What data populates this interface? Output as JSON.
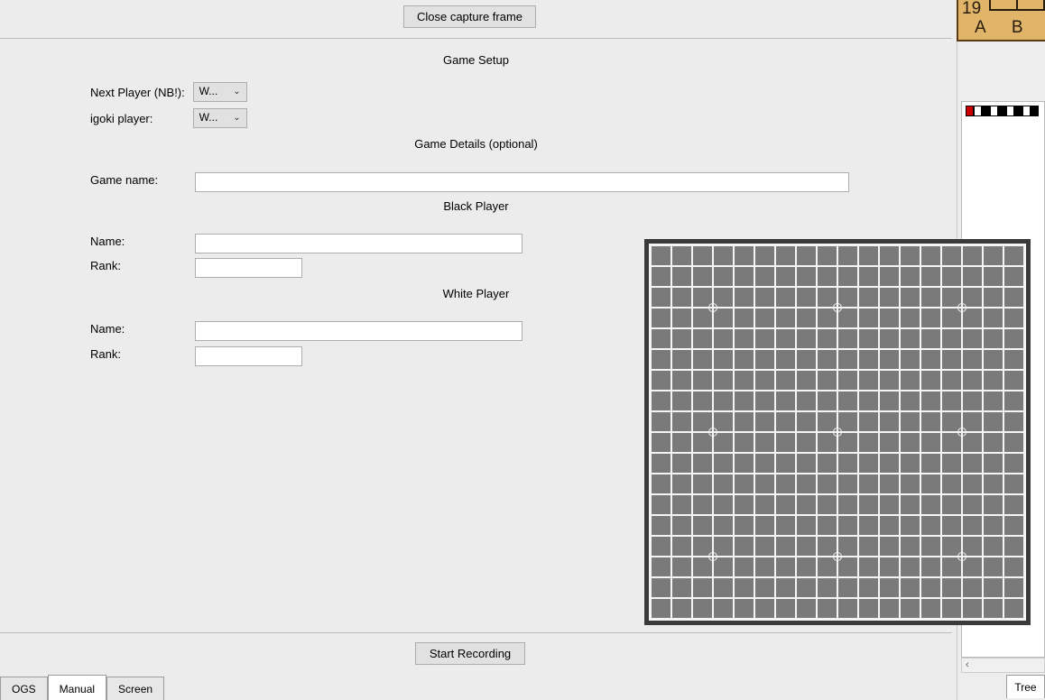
{
  "buttons": {
    "close_capture": "Close capture frame",
    "start_recording": "Start Recording"
  },
  "titles": {
    "setup": "Game Setup",
    "details": "Game Details (optional)",
    "black": "Black Player",
    "white": "White Player"
  },
  "labels": {
    "next_player": "Next Player (NB!):",
    "igoki_player": "igoki player:",
    "game_name": "Game name:",
    "name": "Name:",
    "rank": "Rank:"
  },
  "dropdowns": {
    "next_player_value": "W...",
    "igoki_player_value": "W..."
  },
  "inputs": {
    "game_name": "",
    "black_name": "",
    "black_rank": "",
    "white_name": "",
    "white_rank": ""
  },
  "tabs": {
    "ogs": "OGS",
    "manual": "Manual",
    "screen": "Screen",
    "tree": "Tree",
    "active": "manual"
  },
  "board": {
    "size": 19,
    "hoshi": [
      [
        3,
        3
      ],
      [
        3,
        9
      ],
      [
        3,
        15
      ],
      [
        9,
        3
      ],
      [
        9,
        9
      ],
      [
        9,
        15
      ],
      [
        15,
        3
      ],
      [
        15,
        9
      ],
      [
        15,
        15
      ]
    ]
  },
  "wood": {
    "row_number": "19",
    "columns": "A B C"
  }
}
